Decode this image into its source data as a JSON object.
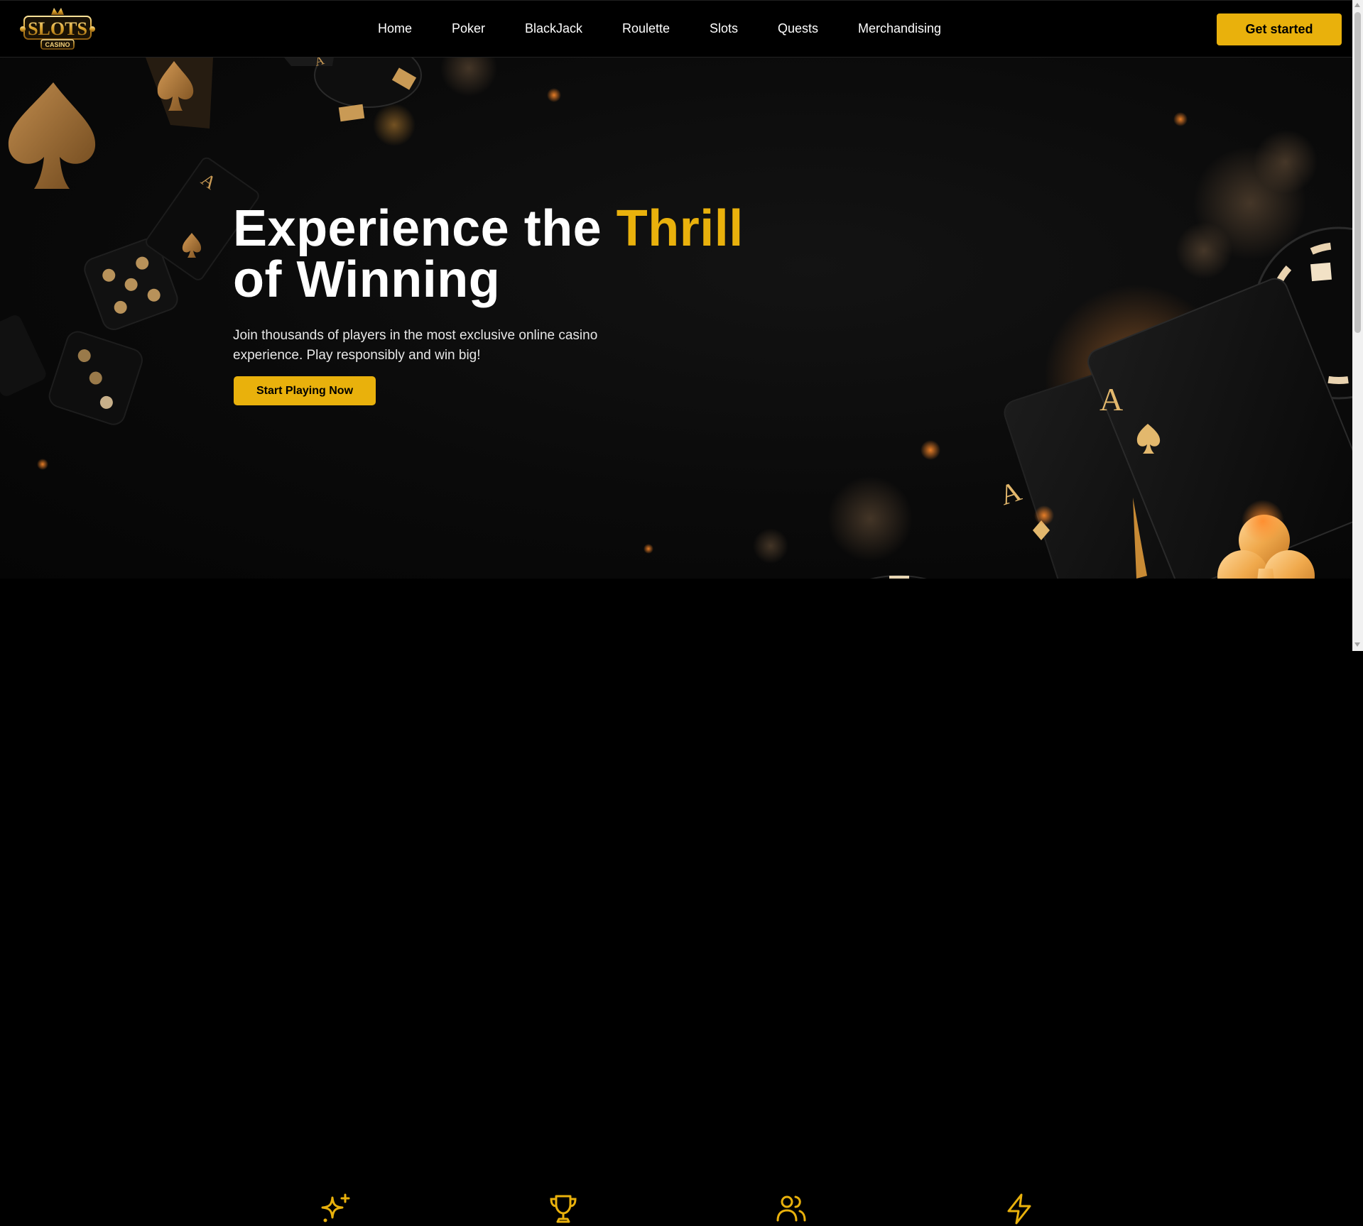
{
  "brand": {
    "logo_text": "SLOTS",
    "logo_sub": "CASINO"
  },
  "nav": {
    "items": [
      {
        "label": "Home"
      },
      {
        "label": "Poker"
      },
      {
        "label": "BlackJack"
      },
      {
        "label": "Roulette"
      },
      {
        "label": "Slots"
      },
      {
        "label": "Quests"
      },
      {
        "label": "Merchandising"
      }
    ],
    "cta_label": "Get started"
  },
  "hero": {
    "title_part1": "Experience the ",
    "title_highlight": "Thrill",
    "title_part2": "of Winning",
    "subtitle": "Join thousands of players in the most exclusive online casino experience. Play responsibly and win big!",
    "cta_label": "Start Playing Now",
    "card_rank": "A"
  },
  "features": {
    "icons": [
      "sparkles-icon",
      "trophy-icon",
      "users-icon",
      "lightning-icon"
    ]
  },
  "colors": {
    "accent": "#e9b10c",
    "background": "#000000",
    "text": "#ffffff"
  }
}
